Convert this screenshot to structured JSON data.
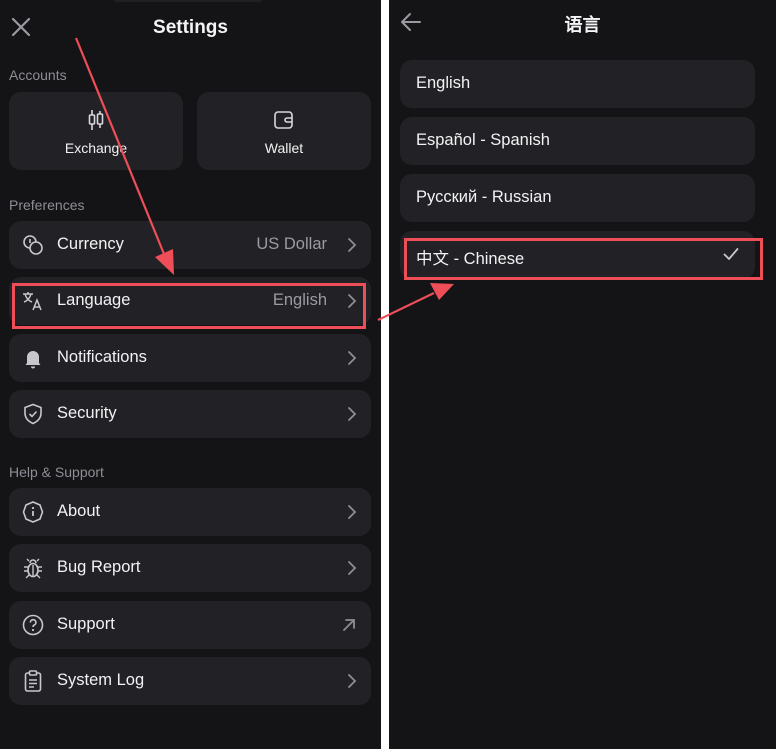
{
  "settings": {
    "title": "Settings",
    "sections": {
      "accounts": "Accounts",
      "preferences": "Preferences",
      "help": "Help & Support"
    },
    "accounts": [
      {
        "label": "Exchange",
        "icon": "candlestick-chart-icon"
      },
      {
        "label": "Wallet",
        "icon": "wallet-icon"
      }
    ],
    "preferences": [
      {
        "label": "Currency",
        "value": "US Dollar",
        "icon": "coins-icon"
      },
      {
        "label": "Language",
        "value": "English",
        "icon": "translate-icon"
      },
      {
        "label": "Notifications",
        "icon": "bell-icon"
      },
      {
        "label": "Security",
        "icon": "shield-icon"
      }
    ],
    "help": [
      {
        "label": "About",
        "icon": "info-icon"
      },
      {
        "label": "Bug Report",
        "icon": "bug-icon"
      },
      {
        "label": "Support",
        "icon": "help-circle-icon"
      },
      {
        "label": "System Log",
        "icon": "clipboard-icon"
      }
    ]
  },
  "language_screen": {
    "title": "语言",
    "options": [
      {
        "label": "English"
      },
      {
        "label": "Español - Spanish"
      },
      {
        "label": "Русский - Russian"
      },
      {
        "label": "中文 - Chinese",
        "selected": true
      }
    ]
  },
  "colors": {
    "background": "#141417",
    "card": "#222226",
    "annotation": "#ee4e58",
    "text_primary": "#f2f2f4",
    "text_secondary": "#8d8d95"
  }
}
